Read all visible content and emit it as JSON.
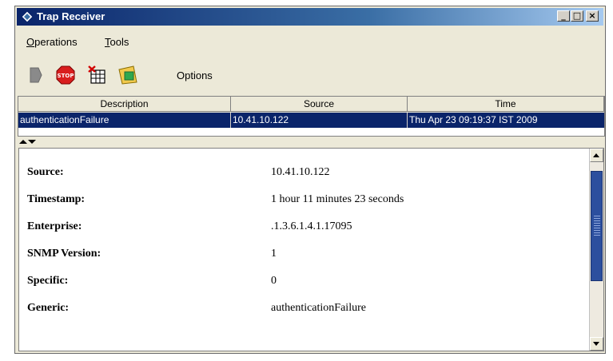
{
  "window": {
    "title": "Trap Receiver",
    "controls": {
      "minimize": "_",
      "maximize": "□",
      "close": "×"
    }
  },
  "menu": [
    {
      "prefix": "",
      "underline": "O",
      "rest": "perations"
    },
    {
      "prefix": "",
      "underline": "T",
      "rest": "ools"
    }
  ],
  "toolbar": {
    "options_label": "Options",
    "icons": [
      "start-icon",
      "stop-icon",
      "delete-traps-icon",
      "parser-icon"
    ],
    "stop_text": "STOP"
  },
  "table": {
    "columns": [
      "Description",
      "Source",
      "Time"
    ],
    "rows": [
      [
        "authenticationFailure",
        "10.41.10.122",
        "Thu Apr 23 09:19:37 IST 2009"
      ]
    ],
    "selected_color": "#0a246a"
  },
  "details": [
    {
      "label": "Source:",
      "value": "10.41.10.122"
    },
    {
      "label": "Timestamp:",
      "value": "1 hour 11 minutes 23 seconds"
    },
    {
      "label": "Enterprise:",
      "value": ".1.3.6.1.4.1.17095"
    },
    {
      "label": "SNMP Version:",
      "value": "1"
    },
    {
      "label": "Specific:",
      "value": "0"
    },
    {
      "label": "Generic:",
      "value": "authenticationFailure"
    }
  ]
}
